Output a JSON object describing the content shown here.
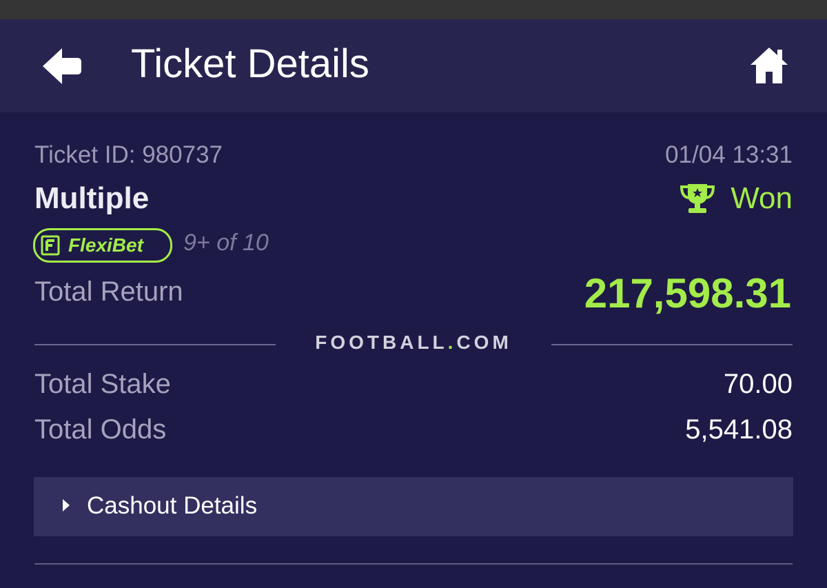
{
  "header": {
    "title": "Ticket Details",
    "back_icon": "arrow-left-icon",
    "home_icon": "home-icon"
  },
  "ticket": {
    "id_label": "Ticket ID: 980737",
    "datetime": "01/04 13:31",
    "bet_type": "Multiple",
    "status": "Won",
    "status_icon": "trophy-icon",
    "flexibet_label": "FlexiBet",
    "flexibet_count": "9+ of 10"
  },
  "totals": {
    "return_label": "Total Return",
    "return_value": "217,598.31",
    "stake_label": "Total Stake",
    "stake_value": "70.00",
    "odds_label": "Total Odds",
    "odds_value": "5,541.08"
  },
  "brand": {
    "name_part1": "FOOTBALL",
    "separator": ".",
    "name_part2": "COM"
  },
  "cashout": {
    "label": "Cashout Details",
    "expand_icon": "caret-right-icon"
  },
  "colors": {
    "background": "#1e1a47",
    "header_background": "#27254f",
    "accent_green": "#a3ec49",
    "panel_background": "#332f5e"
  }
}
